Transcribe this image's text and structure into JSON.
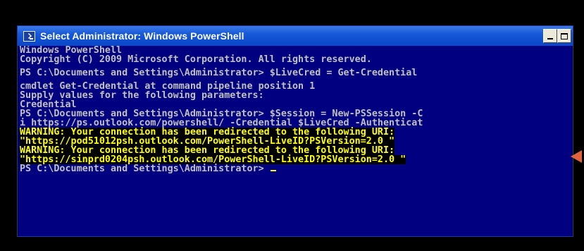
{
  "window": {
    "title": "Select Administrator: Windows PowerShell",
    "icon": "powershell-icon",
    "title_color": "#0a46c9",
    "console_bg": "#000080",
    "console_fg": "#c0c0c0",
    "warning_fg": "#ffff00"
  },
  "console": {
    "lines": [
      "Windows PowerShell",
      "Copyright (C) 2009 Microsoft Corporation. All rights reserved.",
      "PS C:\\Documents and Settings\\Administrator> $LiveCred = Get-Credential",
      "cmdlet Get-Credential at command pipeline position 1",
      "Supply values for the following parameters:",
      "Credential",
      "PS C:\\Documents and Settings\\Administrator> $Session = New-PSSession -C",
      "i https://ps.outlook.com/powershell/ -Credential $LiveCred -Authenticat",
      "WARNING: Your connection has been redirected to the following URI:",
      "\"https://pod51012psh.outlook.com/PowerShell-LiveID?PSVersion=2.0 \"",
      "WARNING: Your connection has been redirected to the following URI:",
      "\"https://sinprd0204psh.outlook.com/PowerShell-LiveID?PSVersion=2.0 \"",
      "PS C:\\Documents and Settings\\Administrator> "
    ]
  },
  "annotation": {
    "arrow_color": "#e0633d"
  }
}
